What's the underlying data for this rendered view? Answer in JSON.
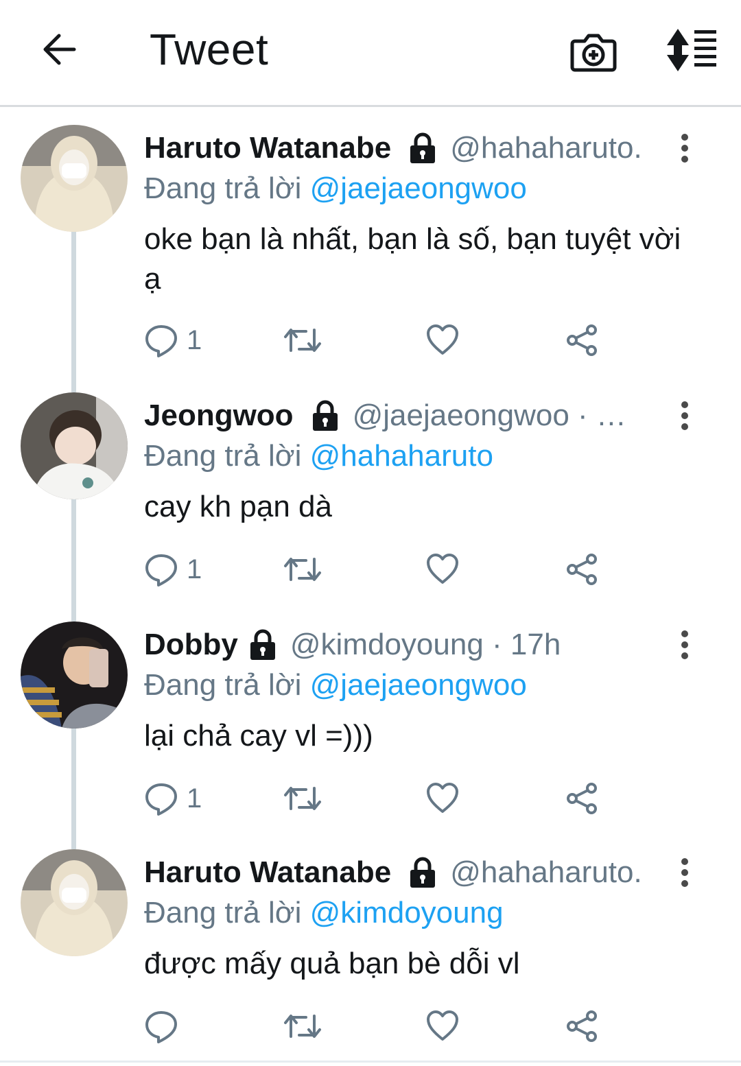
{
  "header": {
    "title": "Tweet"
  },
  "tweets": [
    {
      "name": "Haruto Watanabe",
      "handle": "@hahaharuto.",
      "reply_prefix": "Đang trả lời",
      "reply_to": "@jaejaeongwoo",
      "text": "oke bạn là nhất, bạn là số, bạn tuyệt vời ạ",
      "reply_count": "1"
    },
    {
      "name": "Jeongwoo",
      "handle": "@jaejaeongwoo · …",
      "reply_prefix": "Đang trả lời",
      "reply_to": "@hahaharuto",
      "text": "cay kh pạn dà",
      "reply_count": "1"
    },
    {
      "name": "Dobby",
      "handle": "@kimdoyoung · 17h",
      "reply_prefix": "Đang trả lời",
      "reply_to": "@jaejaeongwoo",
      "text": "lại chả cay vl =)))",
      "reply_count": "1"
    },
    {
      "name": "Haruto Watanabe",
      "handle": "@hahaharuto.",
      "reply_prefix": "Đang trả lời",
      "reply_to": "@kimdoyoung",
      "text": "được mấy quả bạn bè dỗi vl",
      "reply_count": ""
    }
  ],
  "colors": {
    "accent": "#1da1f2",
    "secondary_text": "#657786",
    "thread_line": "#cfd9de"
  },
  "icons": [
    "back-arrow-icon",
    "camera-plus-icon",
    "sort-icon",
    "lock-icon",
    "more-vertical-icon",
    "reply-icon",
    "retweet-icon",
    "like-icon",
    "share-icon"
  ]
}
